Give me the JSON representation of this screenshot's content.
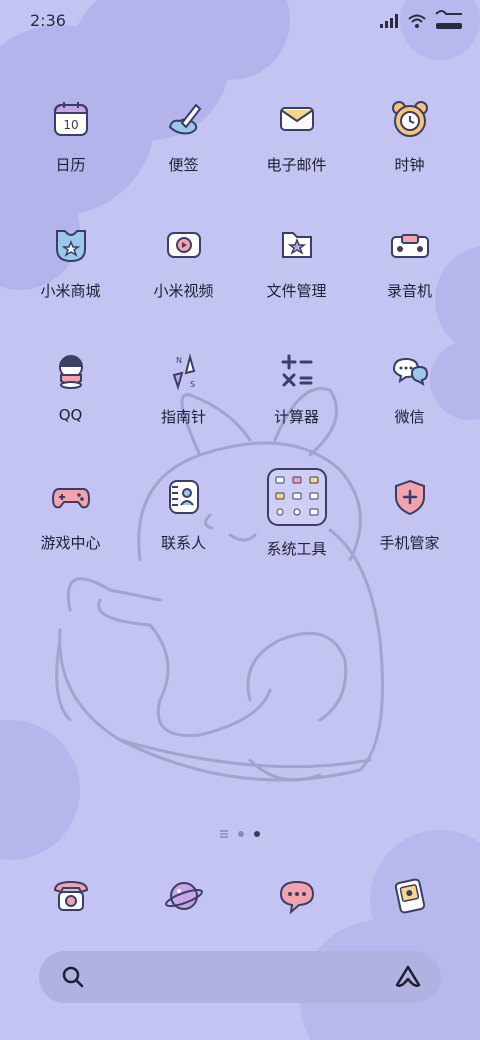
{
  "status_bar": {
    "time": "2:36",
    "icons": [
      "signal-icon",
      "wifi-icon",
      "battery-icon"
    ]
  },
  "home_screen": {
    "apps": [
      {
        "label": "日历",
        "icon": "calendar-icon"
      },
      {
        "label": "便签",
        "icon": "notes-icon"
      },
      {
        "label": "电子邮件",
        "icon": "email-icon"
      },
      {
        "label": "时钟",
        "icon": "clock-icon"
      },
      {
        "label": "小米商城",
        "icon": "mi-store-icon"
      },
      {
        "label": "小米视频",
        "icon": "mi-video-icon"
      },
      {
        "label": "文件管理",
        "icon": "file-manager-icon"
      },
      {
        "label": "录音机",
        "icon": "recorder-icon"
      },
      {
        "label": "QQ",
        "icon": "qq-icon"
      },
      {
        "label": "指南针",
        "icon": "compass-icon"
      },
      {
        "label": "计算器",
        "icon": "calculator-icon"
      },
      {
        "label": "微信",
        "icon": "wechat-icon"
      },
      {
        "label": "游戏中心",
        "icon": "game-center-icon"
      },
      {
        "label": "联系人",
        "icon": "contacts-icon"
      },
      {
        "label": "系统工具",
        "icon": "folder-icon"
      },
      {
        "label": "手机管家",
        "icon": "security-icon"
      }
    ],
    "calendar_date": "10"
  },
  "pager": {
    "pages": 2,
    "current": 2
  },
  "dock": {
    "items": [
      {
        "icon": "phone-icon"
      },
      {
        "icon": "browser-icon"
      },
      {
        "icon": "messages-icon"
      },
      {
        "icon": "gallery-icon"
      }
    ]
  },
  "search_bar": {
    "icons": [
      "search-icon",
      "assistant-icon"
    ]
  },
  "colors": {
    "background": "#c4c4f2",
    "cloud": "#b7b7ec",
    "icon_stroke": "#3b3f66",
    "accent_pink": "#f2a3ae",
    "accent_yellow": "#f6d78a",
    "accent_blue": "#9cc8ee"
  }
}
